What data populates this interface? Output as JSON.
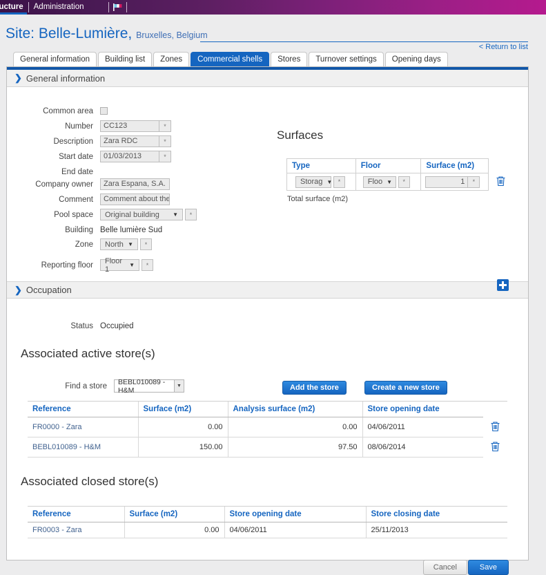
{
  "topnav": {
    "items": [
      {
        "label": "ructure",
        "active": true
      },
      {
        "label": "Administration",
        "active": false
      }
    ],
    "flag_icon": "flag-icon"
  },
  "header": {
    "title_prefix": "Site: Belle-Lumière,",
    "title_location": "Bruxelles, Belgium",
    "return_link": "< Return to list"
  },
  "tabs": [
    {
      "label": "General information",
      "active": false
    },
    {
      "label": "Building list",
      "active": false
    },
    {
      "label": "Zones",
      "active": false
    },
    {
      "label": "Commercial shells",
      "active": true
    },
    {
      "label": "Stores",
      "active": false
    },
    {
      "label": "Turnover settings",
      "active": false
    },
    {
      "label": "Opening days",
      "active": false
    }
  ],
  "general_section": {
    "title": "General information",
    "chevron": "chevron-right-icon",
    "fields": {
      "common_area_label": "Common area",
      "number_label": "Number",
      "number_value": "CC123",
      "description_label": "Description",
      "description_value": "Zara RDC",
      "start_date_label": "Start date",
      "start_date_value": "01/03/2013",
      "end_date_label": "End date",
      "company_owner_label": "Company owner",
      "company_owner_value": "Zara Espana, S.A.",
      "comment_label": "Comment",
      "comment_value": "Comment about the cc",
      "pool_space_label": "Pool space",
      "pool_space_value": "Original building",
      "building_label": "Building",
      "building_value": "Belle lumière Sud",
      "zone_label": "Zone",
      "zone_value": "North",
      "reporting_floor_label": "Reporting floor",
      "reporting_floor_value": "Floor 1",
      "star_glyph": "*",
      "caret_glyph": "▼"
    }
  },
  "surfaces": {
    "title": "Surfaces",
    "columns": [
      "Type",
      "Floor",
      "Surface (m2)"
    ],
    "rows": [
      {
        "type": "Storag",
        "floor": "Floo",
        "surface": "1"
      }
    ],
    "total_label": "Total surface (m2)",
    "delete_icon": "trash-icon",
    "add_icon": "plus-icon"
  },
  "occupation_section": {
    "title": "Occupation",
    "chevron": "chevron-right-icon",
    "status_label": "Status",
    "status_value": "Occupied"
  },
  "active_stores": {
    "heading": "Associated active store(s)",
    "find_label": "Find a store",
    "find_value": "BEBL010089 - H&M",
    "add_button": "Add the store",
    "create_button": "Create a new store",
    "columns": [
      "Reference",
      "Surface (m2)",
      "Analysis surface (m2)",
      "Store opening date"
    ],
    "rows": [
      {
        "reference": "FR0000 - Zara",
        "surface": "0.00",
        "analysis_surface": "0.00",
        "opening_date": "04/06/2011",
        "delete_icon": "trash-icon"
      },
      {
        "reference": "BEBL010089 - H&M",
        "surface": "150.00",
        "analysis_surface": "97.50",
        "opening_date": "08/06/2014",
        "delete_icon": "trash-icon"
      }
    ]
  },
  "closed_stores": {
    "heading": "Associated closed store(s)",
    "columns": [
      "Reference",
      "Surface (m2)",
      "Store opening date",
      "Store closing date"
    ],
    "rows": [
      {
        "reference": "FR0003 - Zara",
        "surface": "0.00",
        "opening_date": "04/06/2011",
        "closing_date": "25/11/2013"
      }
    ]
  },
  "footer": {
    "cancel_label": "Cancel",
    "save_label": "Save"
  },
  "colors": {
    "accent_blue": "#1565c0",
    "header_purple_start": "#3b1248",
    "header_purple_end": "#b51a8e",
    "link_blue": "#41628f",
    "page_bg": "#ececed"
  }
}
